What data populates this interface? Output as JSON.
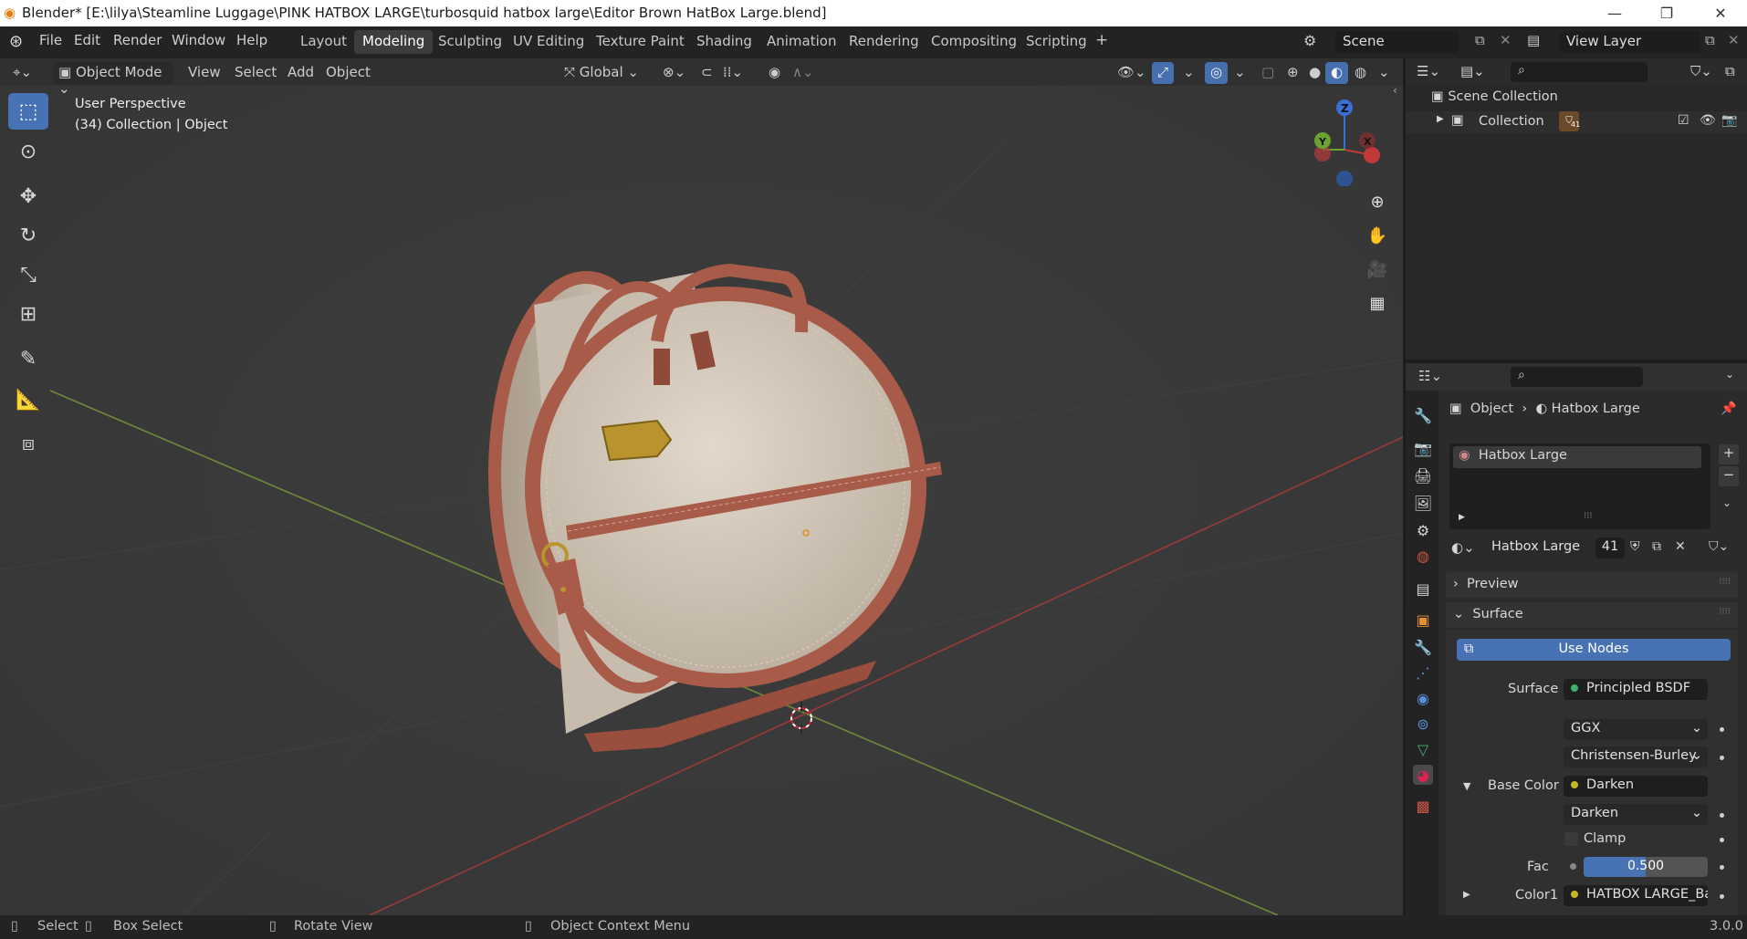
{
  "titlebar": {
    "title": "Blender* [E:\\lilya\\Steamline Luggage\\PINK HATBOX LARGE\\turbosquid hatbox large\\Editor Brown HatBox Large.blend]",
    "minimize": "—",
    "maximize": "❐",
    "close": "✕"
  },
  "menu": [
    "File",
    "Edit",
    "Render",
    "Window",
    "Help"
  ],
  "workspaces": [
    "Layout",
    "Modeling",
    "Sculpting",
    "UV Editing",
    "Texture Paint",
    "Shading",
    "Animation",
    "Rendering",
    "Compositing",
    "Scripting"
  ],
  "workspace_add": "+",
  "scene": {
    "label": "Scene",
    "view_layer": "View Layer"
  },
  "viewport_header": {
    "mode": "Object Mode",
    "menus": [
      "View",
      "Select",
      "Add",
      "Object"
    ],
    "orientation": "Global"
  },
  "viewport_info": {
    "perspective": "User Perspective",
    "collection": "(34) Collection | Object"
  },
  "gizmo": {
    "z": "Z",
    "y": "Y",
    "x": "X"
  },
  "outliner": {
    "scene_collection": "Scene Collection",
    "collection": "Collection",
    "object_count": "41"
  },
  "properties": {
    "breadcrumb_object": "Object",
    "breadcrumb_material": "Hatbox Large",
    "slot_name": "Hatbox Large",
    "material_name": "Hatbox Large",
    "user_count": "41",
    "preview": "Preview",
    "surface_panel": "Surface",
    "use_nodes": "Use Nodes",
    "surface_label": "Surface",
    "surface_value": "Principled BSDF",
    "distribution": "GGX",
    "subsurface": "Christensen-Burley",
    "base_color_label": "Base Color",
    "base_color_value": "Darken",
    "blend_mode": "Darken",
    "clamp": "Clamp",
    "fac_label": "Fac",
    "fac_value": "0.500",
    "fac_fraction": 0.5,
    "color1_label": "Color1",
    "color1_value": "HATBOX LARGE_Ba..."
  },
  "statusbar": {
    "select": "Select",
    "box_select": "Box Select",
    "rotate_view": "Rotate View",
    "context_menu": "Object Context Menu",
    "version": "3.0.0"
  },
  "colors": {
    "accent": "#4772b3",
    "leather": "#a85b48",
    "cream": "#d8cfc1",
    "brass": "#b8932e"
  }
}
